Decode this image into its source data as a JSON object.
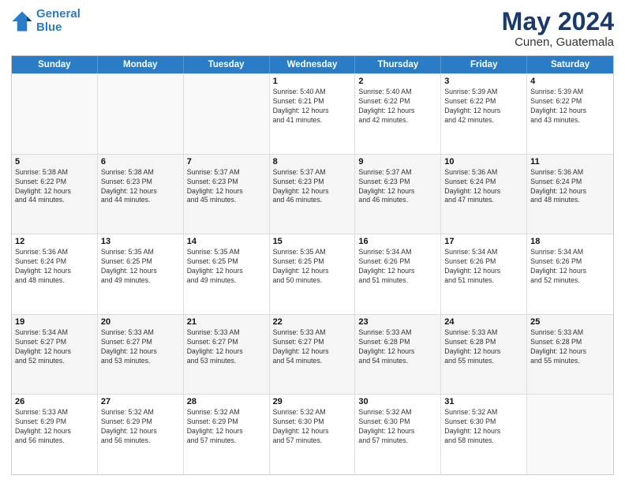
{
  "logo": {
    "line1": "General",
    "line2": "Blue"
  },
  "title": "May 2024",
  "subtitle": "Cunen, Guatemala",
  "days": [
    "Sunday",
    "Monday",
    "Tuesday",
    "Wednesday",
    "Thursday",
    "Friday",
    "Saturday"
  ],
  "weeks": [
    [
      {
        "day": "",
        "info": ""
      },
      {
        "day": "",
        "info": ""
      },
      {
        "day": "",
        "info": ""
      },
      {
        "day": "1",
        "info": "Sunrise: 5:40 AM\nSunset: 6:21 PM\nDaylight: 12 hours\nand 41 minutes."
      },
      {
        "day": "2",
        "info": "Sunrise: 5:40 AM\nSunset: 6:22 PM\nDaylight: 12 hours\nand 42 minutes."
      },
      {
        "day": "3",
        "info": "Sunrise: 5:39 AM\nSunset: 6:22 PM\nDaylight: 12 hours\nand 42 minutes."
      },
      {
        "day": "4",
        "info": "Sunrise: 5:39 AM\nSunset: 6:22 PM\nDaylight: 12 hours\nand 43 minutes."
      }
    ],
    [
      {
        "day": "5",
        "info": "Sunrise: 5:38 AM\nSunset: 6:22 PM\nDaylight: 12 hours\nand 44 minutes."
      },
      {
        "day": "6",
        "info": "Sunrise: 5:38 AM\nSunset: 6:23 PM\nDaylight: 12 hours\nand 44 minutes."
      },
      {
        "day": "7",
        "info": "Sunrise: 5:37 AM\nSunset: 6:23 PM\nDaylight: 12 hours\nand 45 minutes."
      },
      {
        "day": "8",
        "info": "Sunrise: 5:37 AM\nSunset: 6:23 PM\nDaylight: 12 hours\nand 46 minutes."
      },
      {
        "day": "9",
        "info": "Sunrise: 5:37 AM\nSunset: 6:23 PM\nDaylight: 12 hours\nand 46 minutes."
      },
      {
        "day": "10",
        "info": "Sunrise: 5:36 AM\nSunset: 6:24 PM\nDaylight: 12 hours\nand 47 minutes."
      },
      {
        "day": "11",
        "info": "Sunrise: 5:36 AM\nSunset: 6:24 PM\nDaylight: 12 hours\nand 48 minutes."
      }
    ],
    [
      {
        "day": "12",
        "info": "Sunrise: 5:36 AM\nSunset: 6:24 PM\nDaylight: 12 hours\nand 48 minutes."
      },
      {
        "day": "13",
        "info": "Sunrise: 5:35 AM\nSunset: 6:25 PM\nDaylight: 12 hours\nand 49 minutes."
      },
      {
        "day": "14",
        "info": "Sunrise: 5:35 AM\nSunset: 6:25 PM\nDaylight: 12 hours\nand 49 minutes."
      },
      {
        "day": "15",
        "info": "Sunrise: 5:35 AM\nSunset: 6:25 PM\nDaylight: 12 hours\nand 50 minutes."
      },
      {
        "day": "16",
        "info": "Sunrise: 5:34 AM\nSunset: 6:26 PM\nDaylight: 12 hours\nand 51 minutes."
      },
      {
        "day": "17",
        "info": "Sunrise: 5:34 AM\nSunset: 6:26 PM\nDaylight: 12 hours\nand 51 minutes."
      },
      {
        "day": "18",
        "info": "Sunrise: 5:34 AM\nSunset: 6:26 PM\nDaylight: 12 hours\nand 52 minutes."
      }
    ],
    [
      {
        "day": "19",
        "info": "Sunrise: 5:34 AM\nSunset: 6:27 PM\nDaylight: 12 hours\nand 52 minutes."
      },
      {
        "day": "20",
        "info": "Sunrise: 5:33 AM\nSunset: 6:27 PM\nDaylight: 12 hours\nand 53 minutes."
      },
      {
        "day": "21",
        "info": "Sunrise: 5:33 AM\nSunset: 6:27 PM\nDaylight: 12 hours\nand 53 minutes."
      },
      {
        "day": "22",
        "info": "Sunrise: 5:33 AM\nSunset: 6:27 PM\nDaylight: 12 hours\nand 54 minutes."
      },
      {
        "day": "23",
        "info": "Sunrise: 5:33 AM\nSunset: 6:28 PM\nDaylight: 12 hours\nand 54 minutes."
      },
      {
        "day": "24",
        "info": "Sunrise: 5:33 AM\nSunset: 6:28 PM\nDaylight: 12 hours\nand 55 minutes."
      },
      {
        "day": "25",
        "info": "Sunrise: 5:33 AM\nSunset: 6:28 PM\nDaylight: 12 hours\nand 55 minutes."
      }
    ],
    [
      {
        "day": "26",
        "info": "Sunrise: 5:33 AM\nSunset: 6:29 PM\nDaylight: 12 hours\nand 56 minutes."
      },
      {
        "day": "27",
        "info": "Sunrise: 5:32 AM\nSunset: 6:29 PM\nDaylight: 12 hours\nand 56 minutes."
      },
      {
        "day": "28",
        "info": "Sunrise: 5:32 AM\nSunset: 6:29 PM\nDaylight: 12 hours\nand 57 minutes."
      },
      {
        "day": "29",
        "info": "Sunrise: 5:32 AM\nSunset: 6:30 PM\nDaylight: 12 hours\nand 57 minutes."
      },
      {
        "day": "30",
        "info": "Sunrise: 5:32 AM\nSunset: 6:30 PM\nDaylight: 12 hours\nand 57 minutes."
      },
      {
        "day": "31",
        "info": "Sunrise: 5:32 AM\nSunset: 6:30 PM\nDaylight: 12 hours\nand 58 minutes."
      },
      {
        "day": "",
        "info": ""
      }
    ]
  ]
}
